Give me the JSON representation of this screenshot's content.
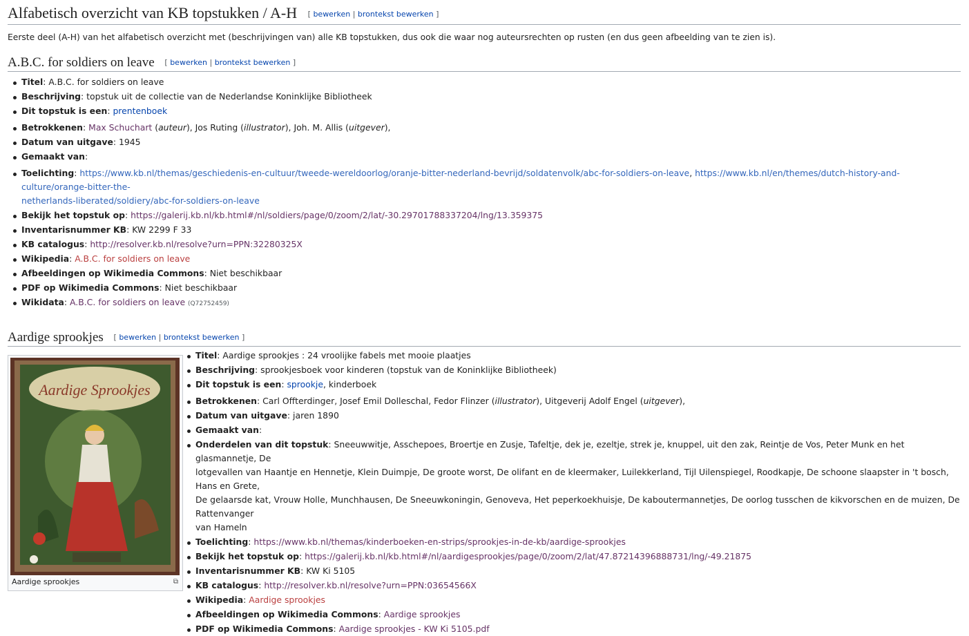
{
  "page": {
    "title": "Alfabetisch overzicht van KB topstukken / A-H",
    "edit_links": {
      "open": "[",
      "edit": "bewerken",
      "sep": "|",
      "source": "brontekst bewerken",
      "close": "]"
    },
    "intro": "Eerste deel (A-H) van het alfabetisch overzicht met (beschrijvingen van) alle KB topstukken, dus ook die waar nog auteursrechten op rusten (en dus geen afbeelding van te zien is)."
  },
  "sections": [
    {
      "heading": "A.B.C. for soldiers on leave",
      "items": {
        "titel_k": "Titel",
        "titel_v": "A.B.C. for soldiers on leave",
        "beschr_k": "Beschrijving",
        "beschr_v": "topstuk uit de collectie van de Nederlandse Koninklijke Bibliotheek",
        "type_k": "Dit topstuk is een",
        "type_link": "prentenboek",
        "betr_k": "Betrokkenen",
        "betr_p1": "Max Schuchart",
        "betr_r1": "auteur",
        "betr_p2": "Jos Ruting",
        "betr_r2": "illustrator",
        "betr_p3": "Joh. M. Allis",
        "betr_r3": "uitgever",
        "datum_k": "Datum van uitgave",
        "datum_v": "1945",
        "gemaakt_k": "Gemaakt van",
        "toel_k": "Toelichting",
        "toel_l1": "https://www.kb.nl/themas/geschiedenis-en-cultuur/tweede-wereldoorlog/oranje-bitter-nederland-bevrijd/soldatenvolk/abc-for-soldiers-on-leave",
        "toel_l2a": "https://www.kb.nl/en/themes/dutch-history-and-culture/orange-bitter-the-",
        "toel_l2b": "netherlands-liberated/soldiery/abc-for-soldiers-on-leave",
        "bekijk_k": "Bekijk het topstuk op",
        "bekijk_v": "https://galerij.kb.nl/kb.html#/nl/soldiers/page/0/zoom/2/lat/-30.29701788337204/lng/13.359375",
        "inv_k": "Inventarisnummer KB",
        "inv_v": "KW 2299 F 33",
        "cat_k": "KB catalogus",
        "cat_v": "http://resolver.kb.nl/resolve?urn=PPN:32280325X",
        "wiki_k": "Wikipedia",
        "wiki_v": "A.B.C. for soldiers on leave",
        "afb_k": "Afbeeldingen op Wikimedia Commons",
        "afb_v": "Niet beschikbaar",
        "pdf_k": "PDF op Wikimedia Commons",
        "pdf_v": "Niet beschikbaar",
        "wd_k": "Wikidata",
        "wd_v": "A.B.C. for soldiers on leave",
        "wd_q": "(Q72752459)"
      }
    },
    {
      "heading": "Aardige sprookjes",
      "thumb_caption": "Aardige sprookjes",
      "items": {
        "titel_k": "Titel",
        "titel_v": "Aardige sprookjes : 24 vroolijke fabels met mooie plaatjes",
        "beschr_k": "Beschrijving",
        "beschr_v": "sprookjesboek voor kinderen (topstuk van de Koninklijke Bibliotheek)",
        "type_k": "Dit topstuk is een",
        "type_link": "sprookje",
        "type_rest": "kinderboek",
        "betr_k": "Betrokkenen",
        "betr_v1": "Carl Offterdinger, Josef Emil Dolleschal, Fedor Flinzer",
        "betr_r1": "illustrator",
        "betr_v2": "Uitgeverij Adolf Engel",
        "betr_r2": "uitgever",
        "datum_k": "Datum van uitgave",
        "datum_v": "jaren 1890",
        "gemaakt_k": "Gemaakt van",
        "ond_k": "Onderdelen van dit topstuk",
        "ond_l1": "Sneeuwwitje, Asschepoes, Broertje en Zusje, Tafeltje, dek je, ezeltje, strek je, knuppel, uit den zak, Reintje de Vos, Peter Munk en het glasmannetje, De",
        "ond_l2": "lotgevallen van Haantje en Hennetje, Klein Duimpje, De groote worst, De olifant en de kleermaker, Luilekkerland, Tijl Uilenspiegel, Roodkapje, De schoone slaapster in 't bosch, Hans en Grete,",
        "ond_l3": "De gelaarsde kat, Vrouw Holle, Munchhausen, De Sneeuwkoningin, Genoveva, Het peperkoekhuisje, De kaboutermannetjes, De oorlog tusschen de kikvorschen en de muizen, De Rattenvanger",
        "ond_l4": "van Hameln",
        "toel_k": "Toelichting",
        "toel_v": "https://www.kb.nl/themas/kinderboeken-en-strips/sprookjes-in-de-kb/aardige-sprookjes",
        "bekijk_k": "Bekijk het topstuk op",
        "bekijk_v": "https://galerij.kb.nl/kb.html#/nl/aardigesprookjes/page/0/zoom/2/lat/47.87214396888731/lng/-49.21875",
        "inv_k": "Inventarisnummer KB",
        "inv_v": "KW Ki 5105",
        "cat_k": "KB catalogus",
        "cat_v": "http://resolver.kb.nl/resolve?urn=PPN:03654566X",
        "wiki_k": "Wikipedia",
        "wiki_v": "Aardige sprookjes",
        "afb_k": "Afbeeldingen op Wikimedia Commons",
        "afb_v": "Aardige sprookjes",
        "pdf_k": "PDF op Wikimedia Commons",
        "pdf_v": "Aardige sprookjes - KW Ki 5105.pdf"
      }
    }
  ]
}
